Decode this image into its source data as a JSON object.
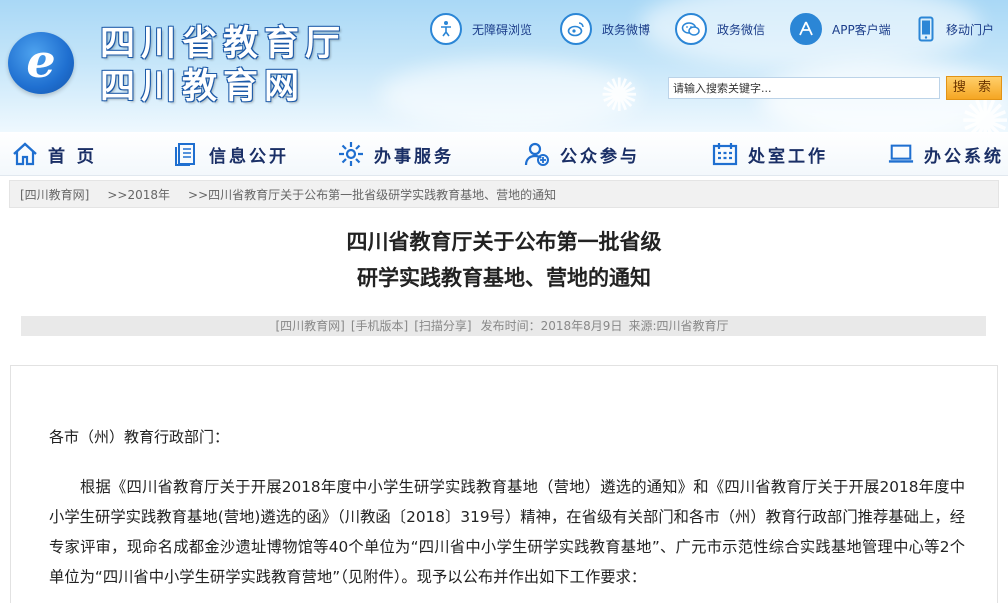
{
  "site": {
    "logo_glyph": "e",
    "title_line1": "四川省教育厅",
    "title_line2": "四川教育网"
  },
  "top_links": [
    {
      "label": "无障碍浏览",
      "icon": "accessibility-icon"
    },
    {
      "label": "政务微博",
      "icon": "weibo-icon"
    },
    {
      "label": "政务微信",
      "icon": "wechat-icon"
    },
    {
      "label": "APP客户端",
      "icon": "app-store-icon"
    },
    {
      "label": "移动门户",
      "icon": "mobile-phone-icon"
    }
  ],
  "search": {
    "value": "请输入搜索关键字...",
    "button_label": "搜 索"
  },
  "nav": [
    {
      "label": "首 页",
      "icon": "home-icon"
    },
    {
      "label": "信息公开",
      "icon": "document-stack-icon"
    },
    {
      "label": "办事服务",
      "icon": "service-gear-icon"
    },
    {
      "label": "公众参与",
      "icon": "user-plus-icon"
    },
    {
      "label": "处室工作",
      "icon": "calendar-icon"
    },
    {
      "label": "办公系统",
      "icon": "laptop-icon"
    }
  ],
  "breadcrumb": {
    "home": "[四川教育网]",
    "year": ">>2018年",
    "current": ">>四川省教育厅关于公布第一批省级研学实践教育基地、营地的通知"
  },
  "article": {
    "title_line1": "四川省教育厅关于公布第一批省级",
    "title_line2": "研学实践教育基地、营地的通知",
    "meta": {
      "site_link": "[四川教育网]",
      "mobile_link": "[手机版本]",
      "share_link": "[扫描分享]",
      "publish_time": "发布时间：2018年8月9日",
      "source": "来源:四川省教育厅"
    },
    "salutation": "各市（州）教育行政部门：",
    "paragraph1": "根据《四川省教育厅关于开展2018年度中小学生研学实践教育基地（营地）遴选的通知》和《四川省教育厅关于开展2018年度中小学生研学实践教育基地(营地)遴选的函》（川教函〔2018〕319号）精神，在省级有关部门和各市（州）教育行政部门推荐基础上，经专家评审，现命名成都金沙遗址博物馆等40个单位为“四川省中小学生研学实践教育基地”、广元市示范性综合实践基地管理中心等2个单位为“四川省中小学生研学实践教育营地”（见附件）。现予以公布并作出如下工作要求："
  },
  "colors": {
    "header_sky": "#a9d8f6",
    "brand_blue": "#1f6fd0",
    "nav_text": "#1a2f66",
    "search_button": "#f5a623"
  }
}
